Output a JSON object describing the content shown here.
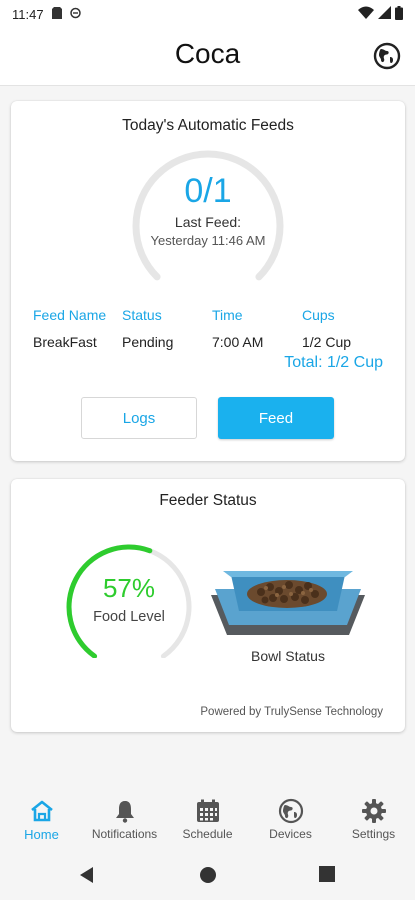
{
  "status_bar": {
    "time": "11:47"
  },
  "header": {
    "title": "Coca"
  },
  "feeds_card": {
    "title": "Today's Automatic Feeds",
    "count_label": "0/1",
    "last_feed_label": "Last Feed:",
    "last_feed_time": "Yesterday 11:46 AM",
    "columns": [
      "Feed Name",
      "Status",
      "Time",
      "Cups"
    ],
    "rows": [
      {
        "name": "BreakFast",
        "status": "Pending",
        "time": "7:00 AM",
        "cups": "1/2 Cup"
      }
    ],
    "total_label": "Total:  1/2 Cup",
    "logs_label": "Logs",
    "feed_label": "Feed",
    "completed_fraction": 0
  },
  "status_card": {
    "title": "Feeder Status",
    "food_level_percent_label": "57%",
    "food_level_fraction": 0.57,
    "food_level_label": "Food Level",
    "bowl_label": "Bowl Status",
    "powered_by": "Powered by TrulySense Technology"
  },
  "bottom_nav": {
    "items": [
      {
        "label": "Home",
        "icon": "home-icon",
        "active": true
      },
      {
        "label": "Notifications",
        "icon": "bell-icon",
        "active": false
      },
      {
        "label": "Schedule",
        "icon": "calendar-icon",
        "active": false
      },
      {
        "label": "Devices",
        "icon": "globe-icon",
        "active": false
      },
      {
        "label": "Settings",
        "icon": "gear-icon",
        "active": false
      }
    ]
  },
  "colors": {
    "accent": "#1aa6e6",
    "button": "#1ab1ee",
    "level": "#2ecc2e",
    "ring_track": "#e6e6e6"
  }
}
